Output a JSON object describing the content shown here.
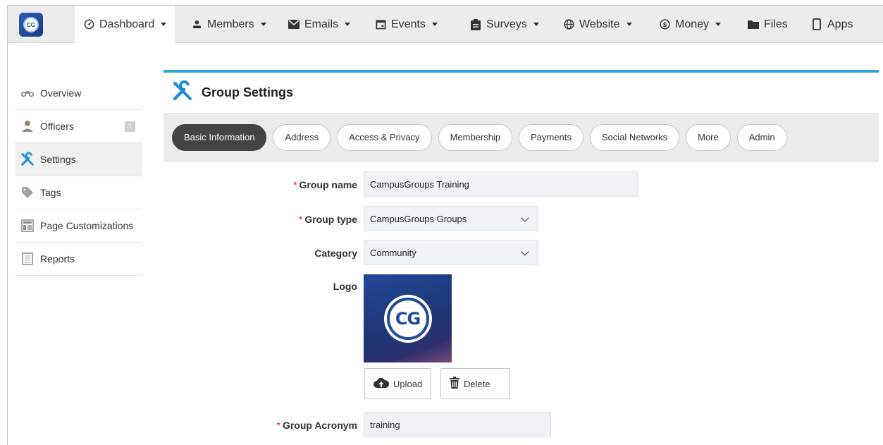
{
  "nav": {
    "items": [
      {
        "label": "Dashboard",
        "icon": "dashboard-icon",
        "dropdown": true
      },
      {
        "label": "Members",
        "icon": "user-icon",
        "dropdown": true
      },
      {
        "label": "Emails",
        "icon": "envelope-icon",
        "dropdown": true
      },
      {
        "label": "Events",
        "icon": "calendar-icon",
        "dropdown": true
      },
      {
        "label": "Surveys",
        "icon": "clipboard-icon",
        "dropdown": true
      },
      {
        "label": "Website",
        "icon": "globe-icon",
        "dropdown": true
      },
      {
        "label": "Money",
        "icon": "dollar-icon",
        "dropdown": true
      },
      {
        "label": "Files",
        "icon": "folder-icon",
        "dropdown": false
      },
      {
        "label": "Apps",
        "icon": "mobile-icon",
        "dropdown": false
      }
    ],
    "logo_text": "CG"
  },
  "sidebar": {
    "items": [
      {
        "label": "Overview",
        "icon": "binoculars-icon"
      },
      {
        "label": "Officers",
        "icon": "officer-icon",
        "badge": "1"
      },
      {
        "label": "Settings",
        "icon": "tools-icon",
        "active": true
      },
      {
        "label": "Tags",
        "icon": "tag-icon"
      },
      {
        "label": "Page Customizations",
        "icon": "layout-icon"
      },
      {
        "label": "Reports",
        "icon": "report-icon"
      }
    ]
  },
  "panel": {
    "title": "Group Settings",
    "accent_color": "#2fa3dc"
  },
  "tabs": [
    {
      "label": "Basic Information",
      "active": true
    },
    {
      "label": "Address"
    },
    {
      "label": "Access & Privacy"
    },
    {
      "label": "Membership"
    },
    {
      "label": "Payments"
    },
    {
      "label": "Social Networks"
    },
    {
      "label": "More"
    },
    {
      "label": "Admin"
    }
  ],
  "form": {
    "group_name": {
      "label": "Group name",
      "required": true,
      "value": "CampusGroups Training"
    },
    "group_type": {
      "label": "Group type",
      "required": true,
      "value": "CampusGroups Groups"
    },
    "category": {
      "label": "Category",
      "required": false,
      "value": "Community"
    },
    "logo": {
      "label": "Logo",
      "image_text": "CG",
      "upload_label": "Upload",
      "delete_label": "Delete"
    },
    "group_acronym": {
      "label": "Group Acronym",
      "required": true,
      "value": "training"
    },
    "required_mark": "*"
  }
}
